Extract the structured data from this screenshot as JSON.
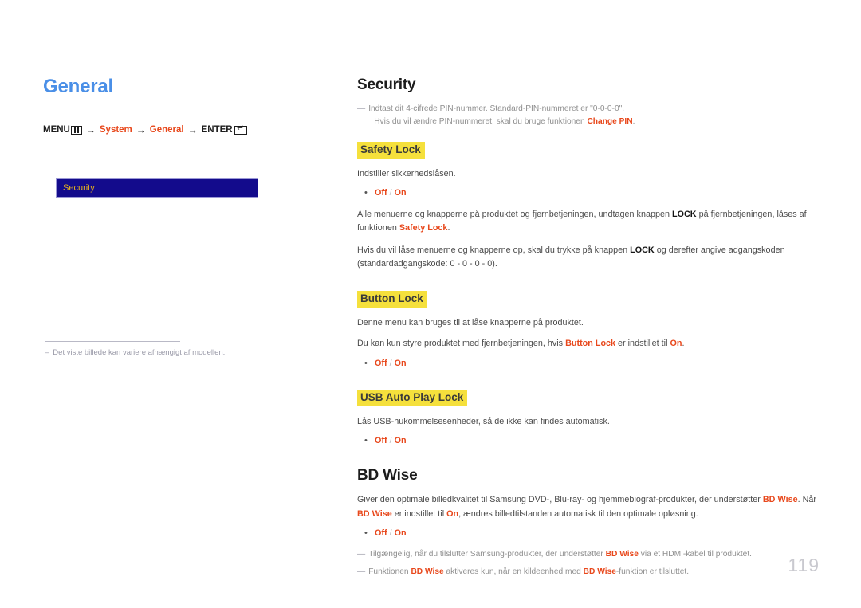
{
  "left": {
    "section_title": "General",
    "menu_path": {
      "menu_label": "MENU",
      "menu_icon": "menu-bars-icon",
      "arrow": "→",
      "step1": "System",
      "step2": "General",
      "enter_label": "ENTER",
      "enter_icon": "enter-return-icon",
      "enter_glyph": "↵"
    },
    "menu_mock": {
      "item_label": "Security",
      "background_color": "#130b8c",
      "text_color": "#e8b31b"
    },
    "note": {
      "dash": "–",
      "text": "Det viste billede kan variere afhængigt af modellen."
    }
  },
  "right": {
    "security": {
      "heading": "Security",
      "intro_note": {
        "dash": "—",
        "line1": "Indtast dit 4-cifrede PIN-nummer. Standard-PIN-nummeret er \"0-0-0-0\".",
        "line2_pre": "Hvis du vil ændre PIN-nummeret, skal du bruge funktionen ",
        "line2_bold": "Change PIN",
        "line2_post": "."
      },
      "safety_lock": {
        "heading": "Safety Lock",
        "desc": "Indstiller sikkerhedslåsen.",
        "options": {
          "off": "Off",
          "sep": " / ",
          "on": "On"
        },
        "p1_a": "Alle menuerne og knapperne på produktet og fjernbetjeningen, undtagen knappen ",
        "p1_lock": "LOCK",
        "p1_b": " på fjernbetjeningen, låses af funktionen ",
        "p1_c": "Safety Lock",
        "p1_d": ".",
        "p2_a": "Hvis du vil låse menuerne og knapperne op, skal du trykke på knappen ",
        "p2_lock": "LOCK",
        "p2_b": " og derefter angive adgangskoden (standardadgangskode: 0 - 0 - 0 - 0)."
      },
      "button_lock": {
        "heading": "Button Lock",
        "desc": "Denne menu kan bruges til at låse knapperne på produktet.",
        "p1_a": "Du kan kun styre produktet med fjernbetjeningen, hvis ",
        "p1_b": "Button Lock",
        "p1_c": " er indstillet til ",
        "p1_d": "On",
        "p1_e": ".",
        "options": {
          "off": "Off",
          "sep": " / ",
          "on": "On"
        }
      },
      "usb_auto_play_lock": {
        "heading": "USB Auto Play Lock",
        "desc": "Lås USB-hukommelsesenheder, så de ikke kan findes automatisk.",
        "options": {
          "off": "Off",
          "sep": " / ",
          "on": "On"
        }
      }
    },
    "bd_wise": {
      "heading": "BD Wise",
      "p1_a": "Giver den optimale billedkvalitet til Samsung DVD-, Blu-ray- og hjemmebiograf-produkter, der understøtter ",
      "p1_b": "BD Wise",
      "p1_c": ". Når ",
      "p1_d": "BD Wise",
      "p1_e": " er indstillet til ",
      "p1_f": "On",
      "p1_g": ", ændres billedtilstanden automatisk til den optimale opløsning.",
      "options": {
        "off": "Off",
        "sep": " / ",
        "on": "On"
      },
      "footnotes": [
        {
          "dash": "—",
          "a": "Tilgængelig, når du tilslutter Samsung-produkter, der understøtter ",
          "b": "BD Wise",
          "c": " via et HDMI-kabel til produktet."
        },
        {
          "dash": "—",
          "a": "Funktionen ",
          "b": "BD Wise",
          "c": " aktiveres kun, når en kildeenhed med ",
          "d": "BD Wise",
          "e": "-funktion er tilsluttet."
        }
      ]
    }
  },
  "page_number": "119",
  "colors": {
    "accent_blue": "#4a8fe7",
    "accent_red": "#e8481c",
    "highlight_yellow": "#f5e03c",
    "menu_blue": "#130b8c",
    "menu_gold": "#e8b31b",
    "page_number_gray": "#c9c9cf"
  }
}
